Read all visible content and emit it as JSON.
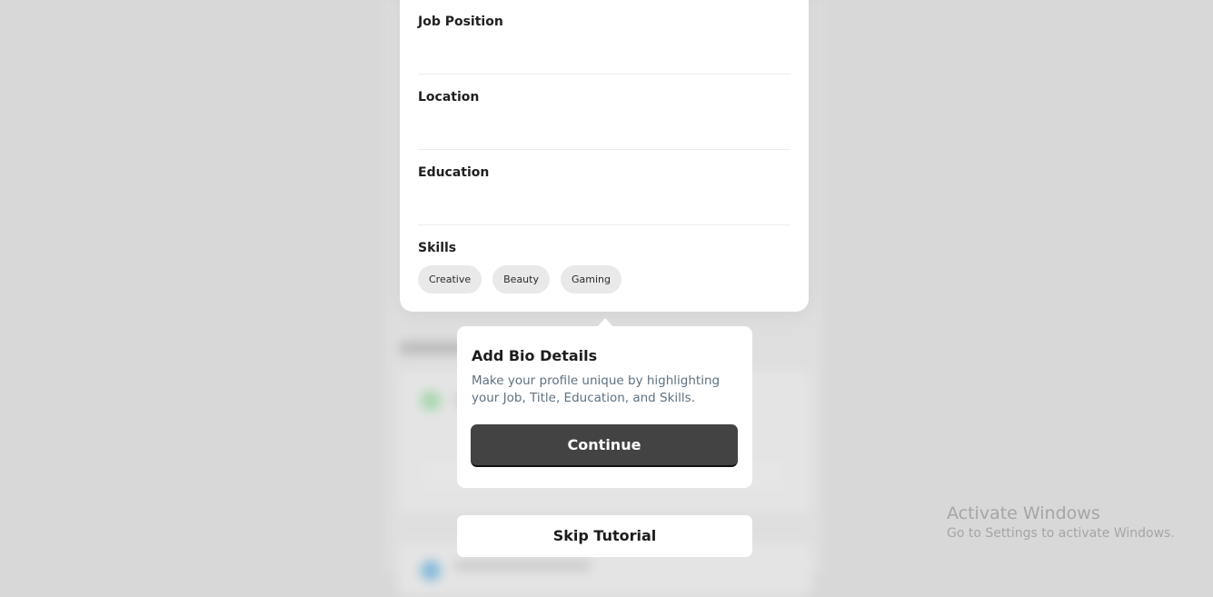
{
  "profile_card": {
    "fields": [
      {
        "label": "Job Position"
      },
      {
        "label": "Location"
      },
      {
        "label": "Education"
      },
      {
        "label": "Skills"
      }
    ],
    "skills": [
      "Creative",
      "Beauty",
      "Gaming"
    ]
  },
  "tutorial": {
    "title": "Add Bio Details",
    "description": "Make your profile unique by highlighting your Job, Title, Education, and Skills.",
    "continue_label": "Continue",
    "skip_label": "Skip Tutorial"
  },
  "watermark": {
    "title": "Activate Windows",
    "subtitle": "Go to Settings to activate Windows."
  }
}
